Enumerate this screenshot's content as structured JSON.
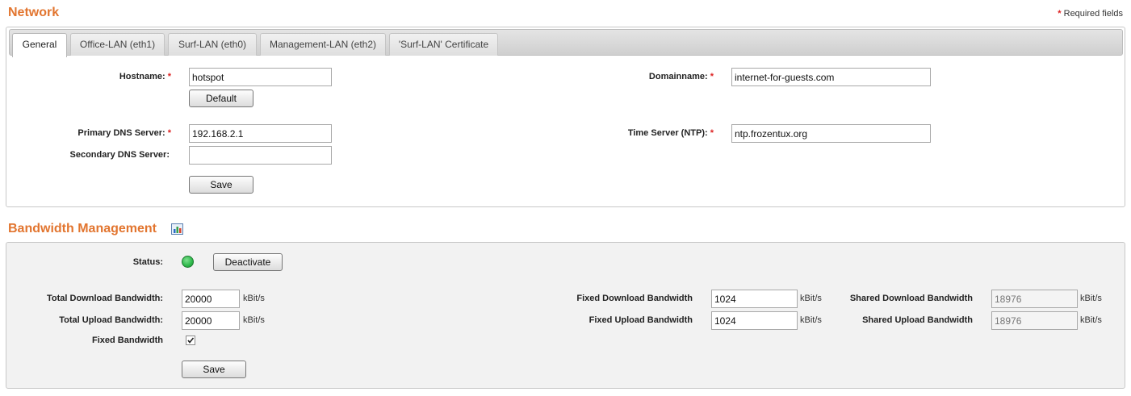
{
  "network": {
    "title": "Network",
    "required_note": "Required fields",
    "required_star": "*",
    "tabs": [
      {
        "label": "General"
      },
      {
        "label": "Office-LAN (eth1)"
      },
      {
        "label": "Surf-LAN (eth0)"
      },
      {
        "label": "Management-LAN (eth2)"
      },
      {
        "label": "'Surf-LAN' Certificate"
      }
    ],
    "hostname": {
      "label": "Hostname:",
      "value": "hotspot"
    },
    "default_button": "Default",
    "domainname": {
      "label": "Domainname:",
      "value": "internet-for-guests.com"
    },
    "primary_dns": {
      "label": "Primary DNS Server:",
      "value": "192.168.2.1"
    },
    "secondary_dns": {
      "label": "Secondary DNS Server:",
      "value": ""
    },
    "time_server": {
      "label": "Time Server (NTP):",
      "value": "ntp.frozentux.org"
    },
    "save_button": "Save"
  },
  "bandwidth": {
    "title": "Bandwidth Management",
    "chart_icon": "chart-icon",
    "status": {
      "label": "Status:",
      "indicator_color": "#2db84a"
    },
    "deactivate_button": "Deactivate",
    "total_download": {
      "label": "Total Download Bandwidth:",
      "value": "20000",
      "unit": "kBit/s"
    },
    "total_upload": {
      "label": "Total Upload Bandwidth:",
      "value": "20000",
      "unit": "kBit/s"
    },
    "fixed_bandwidth": {
      "label": "Fixed Bandwidth",
      "checked": true
    },
    "fixed_download": {
      "label": "Fixed Download Bandwidth",
      "value": "1024",
      "unit": "kBit/s"
    },
    "fixed_upload": {
      "label": "Fixed Upload Bandwidth",
      "value": "1024",
      "unit": "kBit/s"
    },
    "shared_download": {
      "label": "Shared Download Bandwidth",
      "value": "18976",
      "unit": "kBit/s"
    },
    "shared_upload": {
      "label": "Shared Upload Bandwidth",
      "value": "18976",
      "unit": "kBit/s"
    },
    "save_button": "Save"
  },
  "colors": {
    "accent": "#e2752f",
    "required": "#dd2222"
  }
}
